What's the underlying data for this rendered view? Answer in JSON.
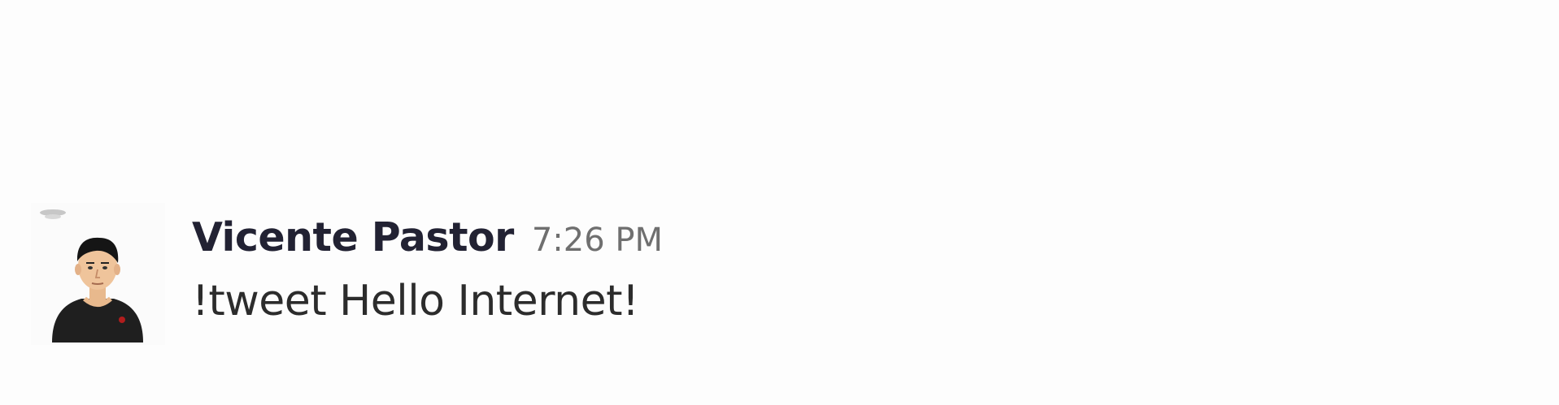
{
  "message": {
    "sender_name": "Vicente Pastor",
    "timestamp": "7:26 PM",
    "text": "!tweet Hello Internet!",
    "avatar": "user-avatar-cartoon"
  },
  "colors": {
    "background": "#fdfdfd",
    "sender": "#222233",
    "timestamp": "#6f6f6f",
    "text": "#2c2c2c"
  }
}
